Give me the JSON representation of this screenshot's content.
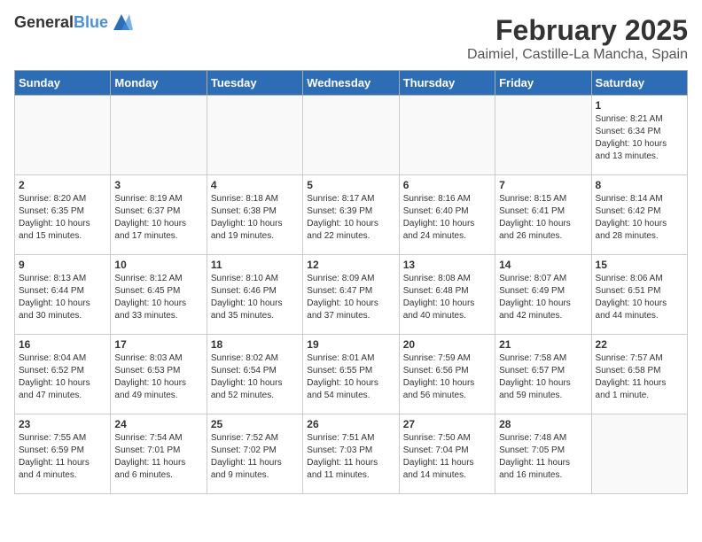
{
  "header": {
    "logo_general": "General",
    "logo_blue": "Blue",
    "month": "February 2025",
    "location": "Daimiel, Castille-La Mancha, Spain"
  },
  "weekdays": [
    "Sunday",
    "Monday",
    "Tuesday",
    "Wednesday",
    "Thursday",
    "Friday",
    "Saturday"
  ],
  "weeks": [
    [
      {
        "day": "",
        "info": ""
      },
      {
        "day": "",
        "info": ""
      },
      {
        "day": "",
        "info": ""
      },
      {
        "day": "",
        "info": ""
      },
      {
        "day": "",
        "info": ""
      },
      {
        "day": "",
        "info": ""
      },
      {
        "day": "1",
        "info": "Sunrise: 8:21 AM\nSunset: 6:34 PM\nDaylight: 10 hours\nand 13 minutes."
      }
    ],
    [
      {
        "day": "2",
        "info": "Sunrise: 8:20 AM\nSunset: 6:35 PM\nDaylight: 10 hours\nand 15 minutes."
      },
      {
        "day": "3",
        "info": "Sunrise: 8:19 AM\nSunset: 6:37 PM\nDaylight: 10 hours\nand 17 minutes."
      },
      {
        "day": "4",
        "info": "Sunrise: 8:18 AM\nSunset: 6:38 PM\nDaylight: 10 hours\nand 19 minutes."
      },
      {
        "day": "5",
        "info": "Sunrise: 8:17 AM\nSunset: 6:39 PM\nDaylight: 10 hours\nand 22 minutes."
      },
      {
        "day": "6",
        "info": "Sunrise: 8:16 AM\nSunset: 6:40 PM\nDaylight: 10 hours\nand 24 minutes."
      },
      {
        "day": "7",
        "info": "Sunrise: 8:15 AM\nSunset: 6:41 PM\nDaylight: 10 hours\nand 26 minutes."
      },
      {
        "day": "8",
        "info": "Sunrise: 8:14 AM\nSunset: 6:42 PM\nDaylight: 10 hours\nand 28 minutes."
      }
    ],
    [
      {
        "day": "9",
        "info": "Sunrise: 8:13 AM\nSunset: 6:44 PM\nDaylight: 10 hours\nand 30 minutes."
      },
      {
        "day": "10",
        "info": "Sunrise: 8:12 AM\nSunset: 6:45 PM\nDaylight: 10 hours\nand 33 minutes."
      },
      {
        "day": "11",
        "info": "Sunrise: 8:10 AM\nSunset: 6:46 PM\nDaylight: 10 hours\nand 35 minutes."
      },
      {
        "day": "12",
        "info": "Sunrise: 8:09 AM\nSunset: 6:47 PM\nDaylight: 10 hours\nand 37 minutes."
      },
      {
        "day": "13",
        "info": "Sunrise: 8:08 AM\nSunset: 6:48 PM\nDaylight: 10 hours\nand 40 minutes."
      },
      {
        "day": "14",
        "info": "Sunrise: 8:07 AM\nSunset: 6:49 PM\nDaylight: 10 hours\nand 42 minutes."
      },
      {
        "day": "15",
        "info": "Sunrise: 8:06 AM\nSunset: 6:51 PM\nDaylight: 10 hours\nand 44 minutes."
      }
    ],
    [
      {
        "day": "16",
        "info": "Sunrise: 8:04 AM\nSunset: 6:52 PM\nDaylight: 10 hours\nand 47 minutes."
      },
      {
        "day": "17",
        "info": "Sunrise: 8:03 AM\nSunset: 6:53 PM\nDaylight: 10 hours\nand 49 minutes."
      },
      {
        "day": "18",
        "info": "Sunrise: 8:02 AM\nSunset: 6:54 PM\nDaylight: 10 hours\nand 52 minutes."
      },
      {
        "day": "19",
        "info": "Sunrise: 8:01 AM\nSunset: 6:55 PM\nDaylight: 10 hours\nand 54 minutes."
      },
      {
        "day": "20",
        "info": "Sunrise: 7:59 AM\nSunset: 6:56 PM\nDaylight: 10 hours\nand 56 minutes."
      },
      {
        "day": "21",
        "info": "Sunrise: 7:58 AM\nSunset: 6:57 PM\nDaylight: 10 hours\nand 59 minutes."
      },
      {
        "day": "22",
        "info": "Sunrise: 7:57 AM\nSunset: 6:58 PM\nDaylight: 11 hours\nand 1 minute."
      }
    ],
    [
      {
        "day": "23",
        "info": "Sunrise: 7:55 AM\nSunset: 6:59 PM\nDaylight: 11 hours\nand 4 minutes."
      },
      {
        "day": "24",
        "info": "Sunrise: 7:54 AM\nSunset: 7:01 PM\nDaylight: 11 hours\nand 6 minutes."
      },
      {
        "day": "25",
        "info": "Sunrise: 7:52 AM\nSunset: 7:02 PM\nDaylight: 11 hours\nand 9 minutes."
      },
      {
        "day": "26",
        "info": "Sunrise: 7:51 AM\nSunset: 7:03 PM\nDaylight: 11 hours\nand 11 minutes."
      },
      {
        "day": "27",
        "info": "Sunrise: 7:50 AM\nSunset: 7:04 PM\nDaylight: 11 hours\nand 14 minutes."
      },
      {
        "day": "28",
        "info": "Sunrise: 7:48 AM\nSunset: 7:05 PM\nDaylight: 11 hours\nand 16 minutes."
      },
      {
        "day": "",
        "info": ""
      }
    ]
  ]
}
